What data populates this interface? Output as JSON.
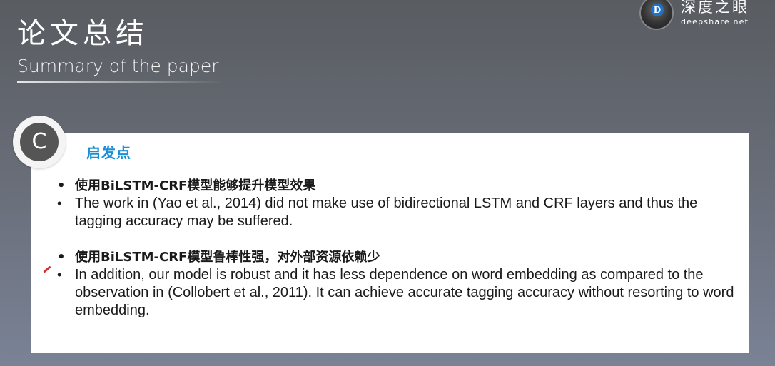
{
  "header": {
    "title": "论文总结",
    "subtitle": "Summary of the paper"
  },
  "brand": {
    "name": "深度之眼",
    "url": "deepshare.net"
  },
  "section": {
    "badge_letter": "C",
    "heading": "启发点"
  },
  "bullets": [
    "使用BiLSTM-CRF模型能够提升模型效果",
    "The work in (Yao et al., 2014) did not make use of bidirectional LSTM and CRF layers and thus the tagging accuracy may be suffered.",
    "使用BiLSTM-CRF模型鲁棒性强，对外部资源依赖少",
    "In addition, our model is robust and it has less dependence on word embedding as compared to the observation in (Collobert et al., 2011). It can achieve accurate tagging accuracy without resorting to word embedding."
  ],
  "colors": {
    "accent": "#1a8fd6",
    "badge": "#555555",
    "card": "#ffffff"
  }
}
